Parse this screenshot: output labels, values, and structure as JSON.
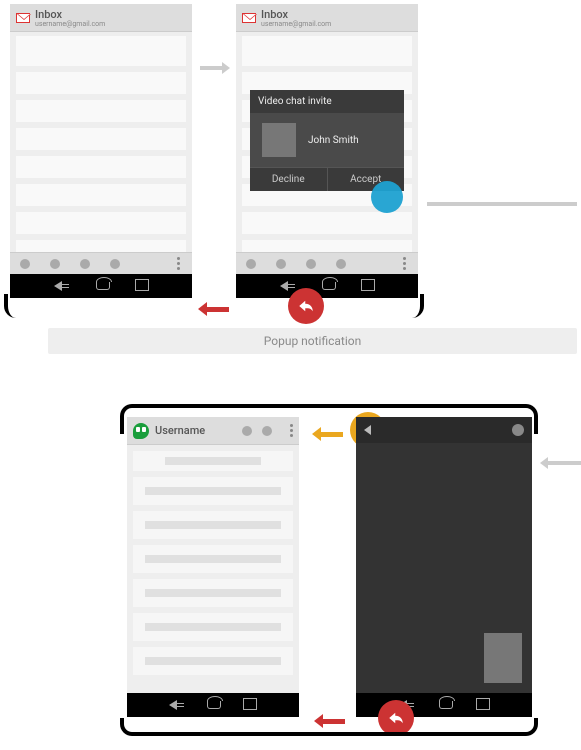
{
  "row1": {
    "phone1": {
      "app_title": "Inbox",
      "app_sub": "username@gmail.com"
    },
    "phone2": {
      "app_title": "Inbox",
      "app_sub": "username@gmail.com",
      "dialog": {
        "title": "Video chat invite",
        "caller": "John Smith",
        "decline": "Decline",
        "accept": "Accept"
      }
    },
    "label": "Popup notification"
  },
  "row2": {
    "phone3": {
      "username": "Username"
    }
  }
}
